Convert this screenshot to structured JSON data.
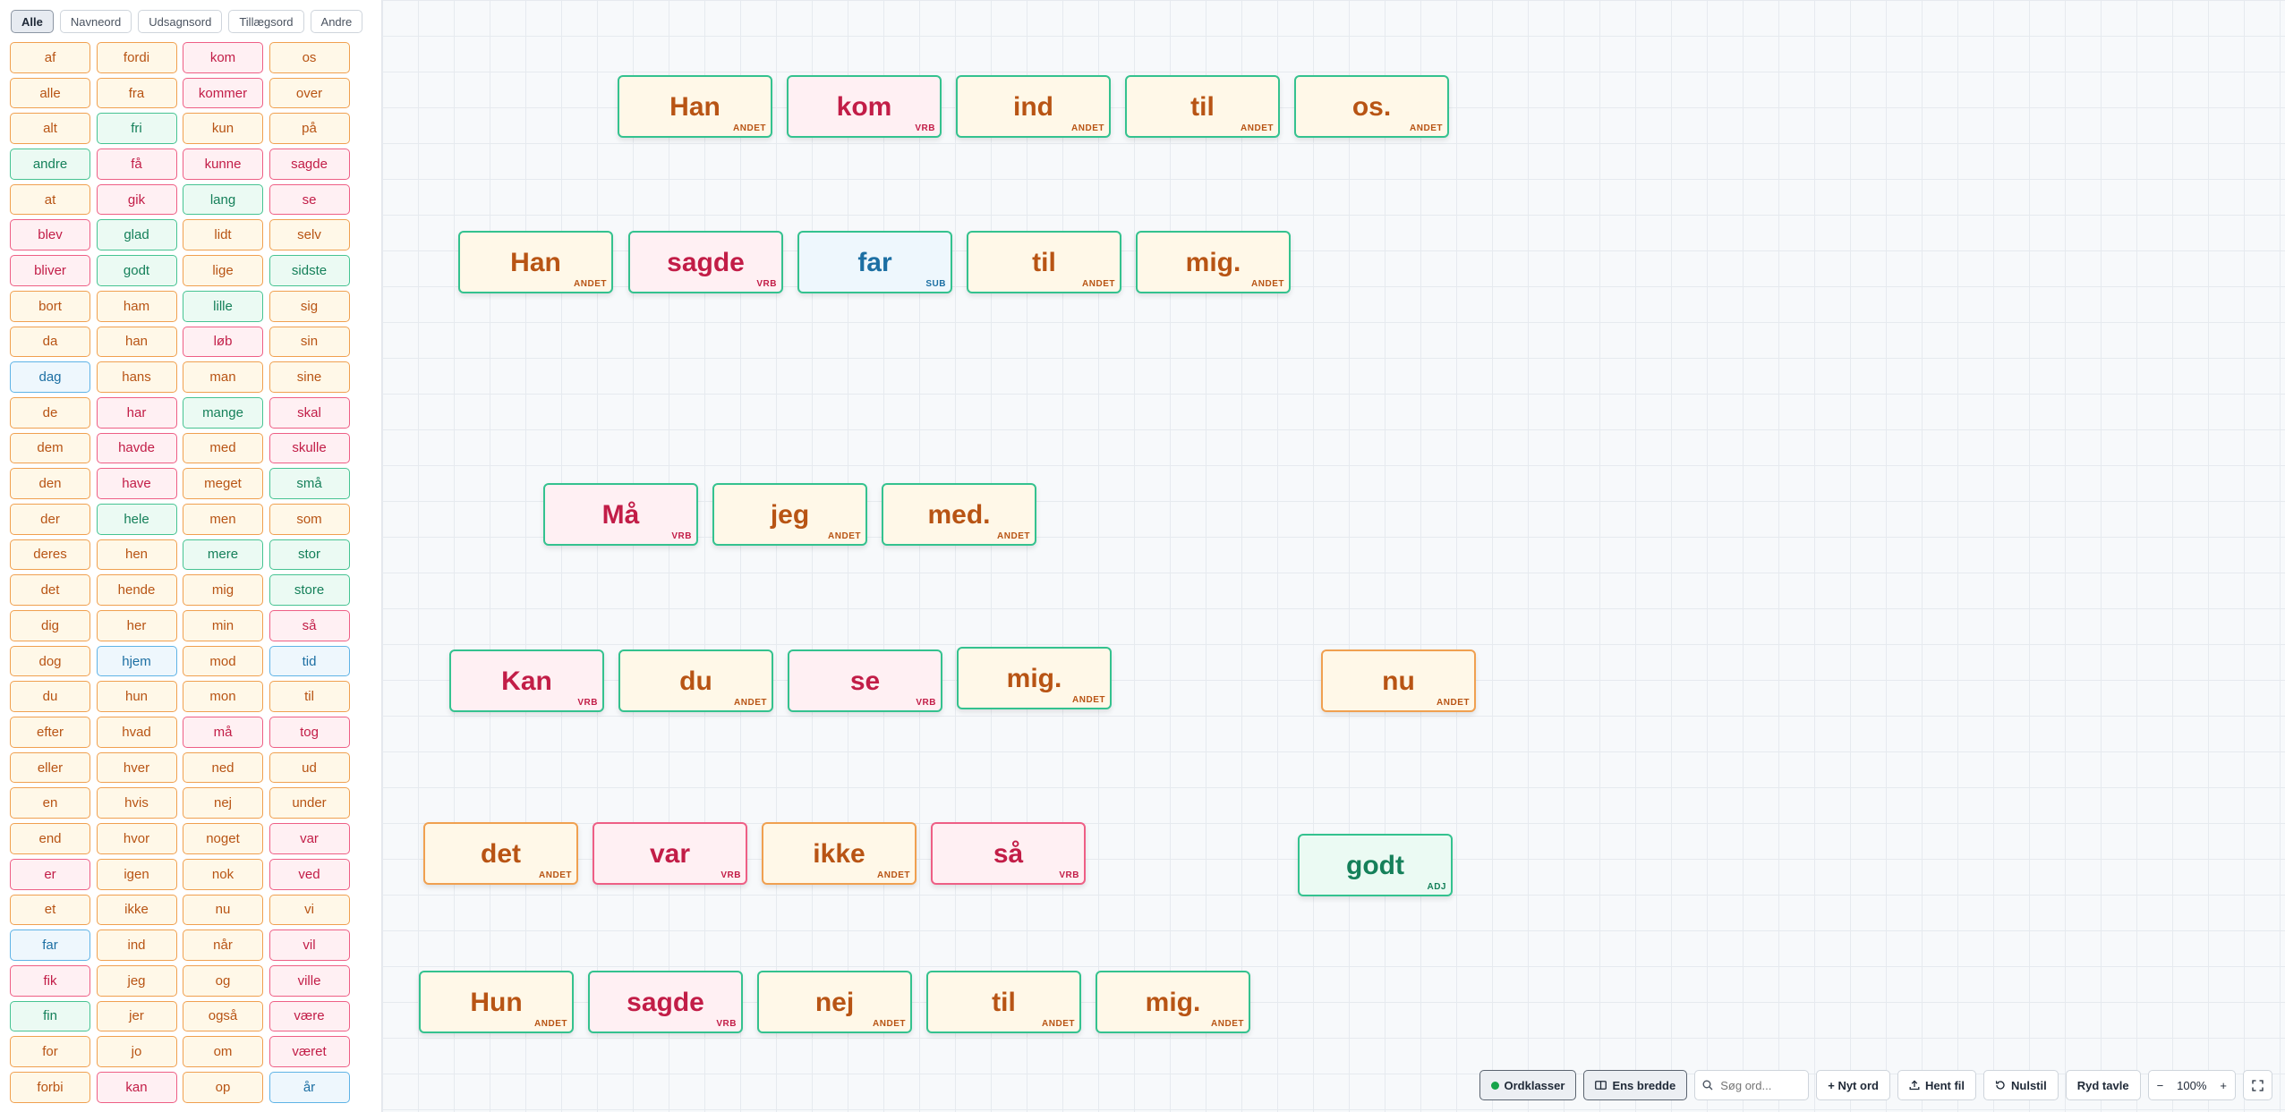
{
  "filters": [
    {
      "label": "Alle",
      "active": true
    },
    {
      "label": "Navneord",
      "active": false
    },
    {
      "label": "Udsagnsord",
      "active": false
    },
    {
      "label": "Tillægsord",
      "active": false
    },
    {
      "label": "Andre",
      "active": false
    }
  ],
  "colors": {
    "ANDET": {
      "text": "#b85414",
      "bg": "#fff8e8",
      "border": "#f0a050"
    },
    "VRB": {
      "text": "#c21d47",
      "bg": "#fff0f3",
      "border": "#ee5f85"
    },
    "SUB": {
      "text": "#1c6fa3",
      "bg": "#eef7fd",
      "border": "#5fb3e6"
    },
    "ADJ": {
      "text": "#15805a",
      "bg": "#ebfaf3",
      "border": "#46c392"
    },
    "card_border": "#34c28f"
  },
  "words": [
    [
      "af",
      "ANDET"
    ],
    [
      "alle",
      "ANDET"
    ],
    [
      "alt",
      "ANDET"
    ],
    [
      "andre",
      "ADJ"
    ],
    [
      "at",
      "ANDET"
    ],
    [
      "blev",
      "VRB"
    ],
    [
      "bliver",
      "VRB"
    ],
    [
      "bort",
      "ANDET"
    ],
    [
      "da",
      "ANDET"
    ],
    [
      "dag",
      "SUB"
    ],
    [
      "de",
      "ANDET"
    ],
    [
      "dem",
      "ANDET"
    ],
    [
      "den",
      "ANDET"
    ],
    [
      "der",
      "ANDET"
    ],
    [
      "deres",
      "ANDET"
    ],
    [
      "det",
      "ANDET"
    ],
    [
      "dig",
      "ANDET"
    ],
    [
      "dog",
      "ANDET"
    ],
    [
      "du",
      "ANDET"
    ],
    [
      "efter",
      "ANDET"
    ],
    [
      "eller",
      "ANDET"
    ],
    [
      "en",
      "ANDET"
    ],
    [
      "end",
      "ANDET"
    ],
    [
      "er",
      "VRB"
    ],
    [
      "et",
      "ANDET"
    ],
    [
      "far",
      "SUB"
    ],
    [
      "fik",
      "VRB"
    ],
    [
      "fin",
      "ADJ"
    ],
    [
      "for",
      "ANDET"
    ],
    [
      "forbi",
      "ANDET"
    ],
    [
      "fordi",
      "ANDET"
    ],
    [
      "fra",
      "ANDET"
    ],
    [
      "fri",
      "ADJ"
    ],
    [
      "få",
      "VRB"
    ],
    [
      "gik",
      "VRB"
    ],
    [
      "glad",
      "ADJ"
    ],
    [
      "godt",
      "ADJ"
    ],
    [
      "ham",
      "ANDET"
    ],
    [
      "han",
      "ANDET"
    ],
    [
      "hans",
      "ANDET"
    ],
    [
      "har",
      "VRB"
    ],
    [
      "havde",
      "VRB"
    ],
    [
      "have",
      "VRB"
    ],
    [
      "hele",
      "ADJ"
    ],
    [
      "hen",
      "ANDET"
    ],
    [
      "hende",
      "ANDET"
    ],
    [
      "her",
      "ANDET"
    ],
    [
      "hjem",
      "SUB"
    ],
    [
      "hun",
      "ANDET"
    ],
    [
      "hvad",
      "ANDET"
    ],
    [
      "hver",
      "ANDET"
    ],
    [
      "hvis",
      "ANDET"
    ],
    [
      "hvor",
      "ANDET"
    ],
    [
      "igen",
      "ANDET"
    ],
    [
      "ikke",
      "ANDET"
    ],
    [
      "ind",
      "ANDET"
    ],
    [
      "jeg",
      "ANDET"
    ],
    [
      "jer",
      "ANDET"
    ],
    [
      "jo",
      "ANDET"
    ],
    [
      "kan",
      "VRB"
    ],
    [
      "kom",
      "VRB"
    ],
    [
      "kommer",
      "VRB"
    ],
    [
      "kun",
      "ANDET"
    ],
    [
      "kunne",
      "VRB"
    ],
    [
      "lang",
      "ADJ"
    ],
    [
      "lidt",
      "ANDET"
    ],
    [
      "lige",
      "ANDET"
    ],
    [
      "lille",
      "ADJ"
    ],
    [
      "løb",
      "VRB"
    ],
    [
      "man",
      "ANDET"
    ],
    [
      "mange",
      "ADJ"
    ],
    [
      "med",
      "ANDET"
    ],
    [
      "meget",
      "ANDET"
    ],
    [
      "men",
      "ANDET"
    ],
    [
      "mere",
      "ADJ"
    ],
    [
      "mig",
      "ANDET"
    ],
    [
      "min",
      "ANDET"
    ],
    [
      "mod",
      "ANDET"
    ],
    [
      "mon",
      "ANDET"
    ],
    [
      "må",
      "VRB"
    ],
    [
      "ned",
      "ANDET"
    ],
    [
      "nej",
      "ANDET"
    ],
    [
      "noget",
      "ANDET"
    ],
    [
      "nok",
      "ANDET"
    ],
    [
      "nu",
      "ANDET"
    ],
    [
      "når",
      "ANDET"
    ],
    [
      "og",
      "ANDET"
    ],
    [
      "også",
      "ANDET"
    ],
    [
      "om",
      "ANDET"
    ],
    [
      "op",
      "ANDET"
    ],
    [
      "os",
      "ANDET"
    ],
    [
      "over",
      "ANDET"
    ],
    [
      "på",
      "ANDET"
    ],
    [
      "sagde",
      "VRB"
    ],
    [
      "se",
      "VRB"
    ],
    [
      "selv",
      "ANDET"
    ],
    [
      "sidste",
      "ADJ"
    ],
    [
      "sig",
      "ANDET"
    ],
    [
      "sin",
      "ANDET"
    ],
    [
      "sine",
      "ANDET"
    ],
    [
      "skal",
      "VRB"
    ],
    [
      "skulle",
      "VRB"
    ],
    [
      "små",
      "ADJ"
    ],
    [
      "som",
      "ANDET"
    ],
    [
      "stor",
      "ADJ"
    ],
    [
      "store",
      "ADJ"
    ],
    [
      "så",
      "VRB"
    ],
    [
      "tid",
      "SUB"
    ],
    [
      "til",
      "ANDET"
    ],
    [
      "tog",
      "VRB"
    ],
    [
      "ud",
      "ANDET"
    ],
    [
      "under",
      "ANDET"
    ],
    [
      "var",
      "VRB"
    ],
    [
      "ved",
      "VRB"
    ],
    [
      "vi",
      "ANDET"
    ],
    [
      "vil",
      "VRB"
    ],
    [
      "ville",
      "VRB"
    ],
    [
      "være",
      "VRB"
    ],
    [
      "været",
      "VRB"
    ],
    [
      "år",
      "SUB"
    ]
  ],
  "board_cards": [
    {
      "word": "Han",
      "tag": "ANDET",
      "border": "green"
    },
    {
      "word": "kom",
      "tag": "VRB",
      "border": "green"
    },
    {
      "word": "ind",
      "tag": "ANDET",
      "border": "green"
    },
    {
      "word": "til",
      "tag": "ANDET",
      "border": "green"
    },
    {
      "word": "os.",
      "tag": "ANDET",
      "border": "green"
    },
    {
      "word": "Han",
      "tag": "ANDET",
      "border": "green"
    },
    {
      "word": "sagde",
      "tag": "VRB",
      "border": "green"
    },
    {
      "word": "far",
      "tag": "SUB",
      "border": "green"
    },
    {
      "word": "til",
      "tag": "ANDET",
      "border": "green"
    },
    {
      "word": "mig.",
      "tag": "ANDET",
      "border": "green"
    },
    {
      "word": "Må",
      "tag": "VRB",
      "border": "green"
    },
    {
      "word": "jeg",
      "tag": "ANDET",
      "border": "green"
    },
    {
      "word": "med.",
      "tag": "ANDET",
      "border": "green"
    },
    {
      "word": "Kan",
      "tag": "VRB",
      "border": "green"
    },
    {
      "word": "du",
      "tag": "ANDET",
      "border": "green"
    },
    {
      "word": "se",
      "tag": "VRB",
      "border": "green"
    },
    {
      "word": "mig.",
      "tag": "ANDET",
      "border": "green"
    },
    {
      "word": "nu",
      "tag": "ANDET",
      "border": "category"
    },
    {
      "word": "det",
      "tag": "ANDET",
      "border": "category"
    },
    {
      "word": "var",
      "tag": "VRB",
      "border": "category"
    },
    {
      "word": "ikke",
      "tag": "ANDET",
      "border": "category"
    },
    {
      "word": "så",
      "tag": "VRB",
      "border": "category"
    },
    {
      "word": "godt",
      "tag": "ADJ",
      "border": "green"
    },
    {
      "word": "Hun",
      "tag": "ANDET",
      "border": "green"
    },
    {
      "word": "sagde",
      "tag": "VRB",
      "border": "green"
    },
    {
      "word": "nej",
      "tag": "ANDET",
      "border": "green"
    },
    {
      "word": "til",
      "tag": "ANDET",
      "border": "green"
    },
    {
      "word": "mig.",
      "tag": "ANDET",
      "border": "green"
    }
  ],
  "toolbar": {
    "wordclasses_label": "Ordklasser",
    "equal_width_label": "Ens bredde",
    "search_placeholder": "Søg ord...",
    "new_word_label": "+ Nyt ord",
    "load_file_label": "Hent fil",
    "reset_label": "Nulstil",
    "clear_board_label": "Ryd tavle",
    "zoom_minus": "−",
    "zoom_level": "100%",
    "zoom_plus": "+",
    "icons": {
      "wordclasses": "status-dot-icon",
      "equal_width": "columns-icon",
      "search": "search-icon",
      "load_file": "upload-icon",
      "reset": "rotate-ccw-icon",
      "fullscreen": "fullscreen-icon"
    }
  }
}
